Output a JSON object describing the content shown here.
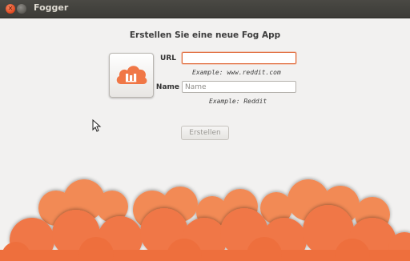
{
  "window": {
    "title": "Fogger"
  },
  "form": {
    "heading": "Erstellen Sie eine neue Fog App",
    "url_label": "URL",
    "url_value": "",
    "url_hint": "Example: www.reddit.com",
    "name_label": "Name",
    "name_placeholder": "Name",
    "name_hint": "Example: Reddit",
    "create_label": "Erstellen"
  },
  "icons": {
    "app_icon": "cloud-books-icon",
    "close": "close-icon",
    "minimize": "minimize-icon"
  },
  "colors": {
    "accent": "#f07746",
    "cloud_light": "#f28a55",
    "titlebar": "#3c3b37"
  }
}
